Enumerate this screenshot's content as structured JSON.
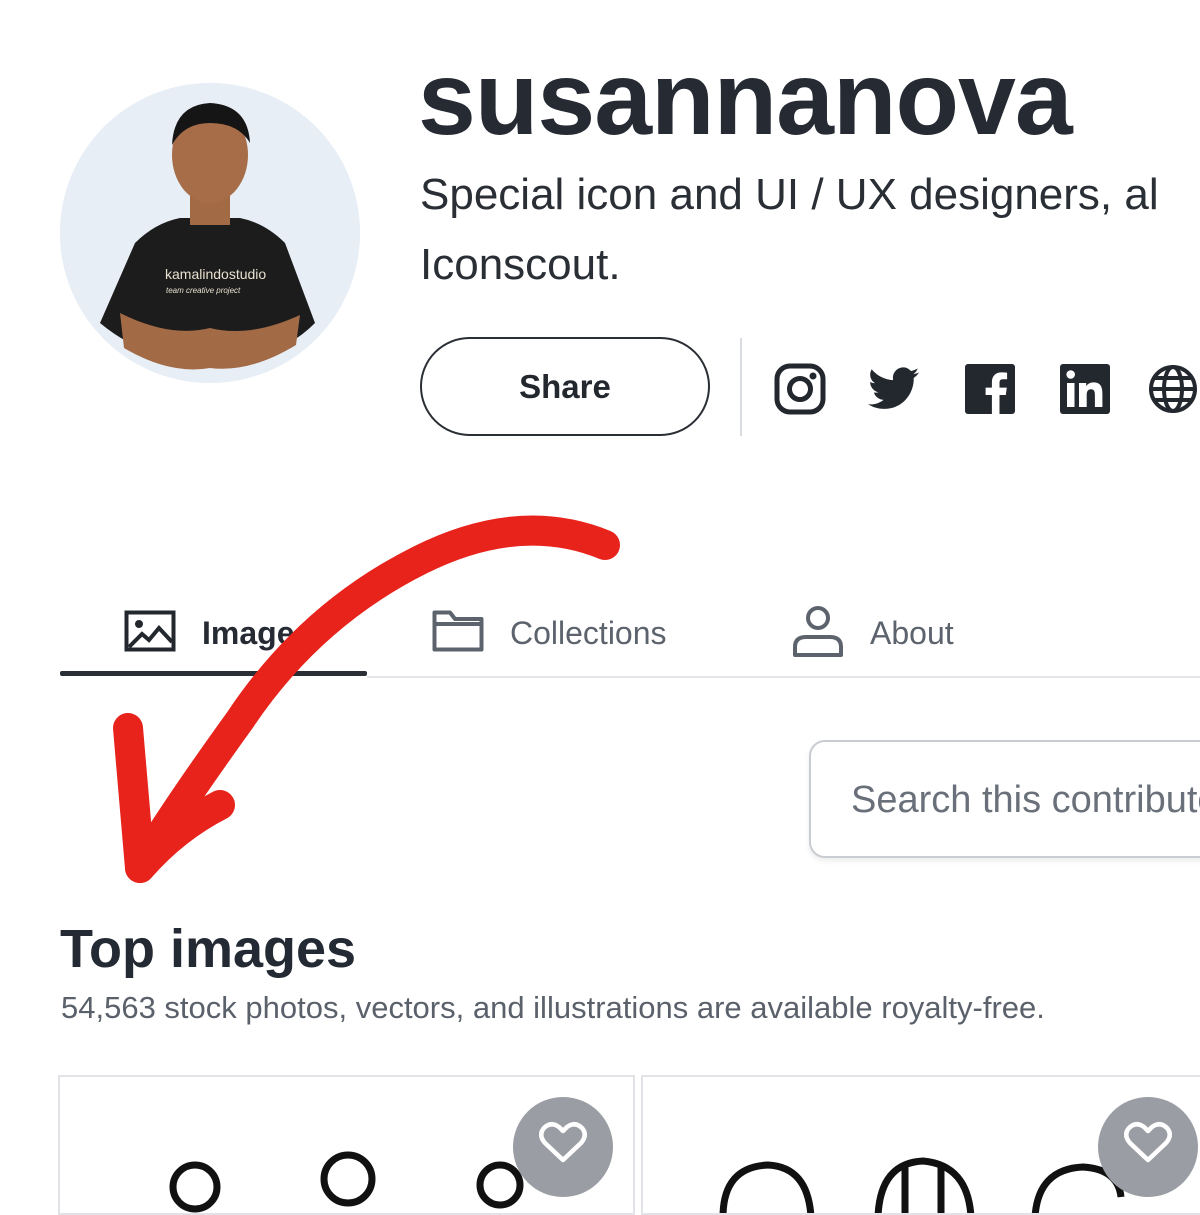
{
  "profile": {
    "username": "susannanova",
    "bio_line1": "Special icon and UI / UX designers, al",
    "bio_line2": "Iconscout.",
    "avatar_shirt_text": "kamalindostudio",
    "avatar_shirt_subtext": "team creative project",
    "share_label": "Share"
  },
  "social_icons": [
    "instagram-icon",
    "twitter-icon",
    "facebook-icon",
    "linkedin-icon",
    "globe-icon"
  ],
  "tabs": [
    {
      "label": "Images",
      "icon": "image-icon",
      "active": true
    },
    {
      "label": "Collections",
      "icon": "folder-icon",
      "active": false
    },
    {
      "label": "About",
      "icon": "person-icon",
      "active": false
    }
  ],
  "search": {
    "placeholder": "Search this contributor's images"
  },
  "section": {
    "title": "Top images",
    "subtitle": "54,563 stock photos, vectors, and illustrations are available royalty-free."
  },
  "cards": [
    {
      "favorite_icon": "heart-icon"
    },
    {
      "favorite_icon": "heart-icon"
    }
  ],
  "colors": {
    "annotation": "#e8231c",
    "text_primary": "#242a33",
    "text_secondary": "#5b616b",
    "avatar_bg": "#e8eef6"
  }
}
